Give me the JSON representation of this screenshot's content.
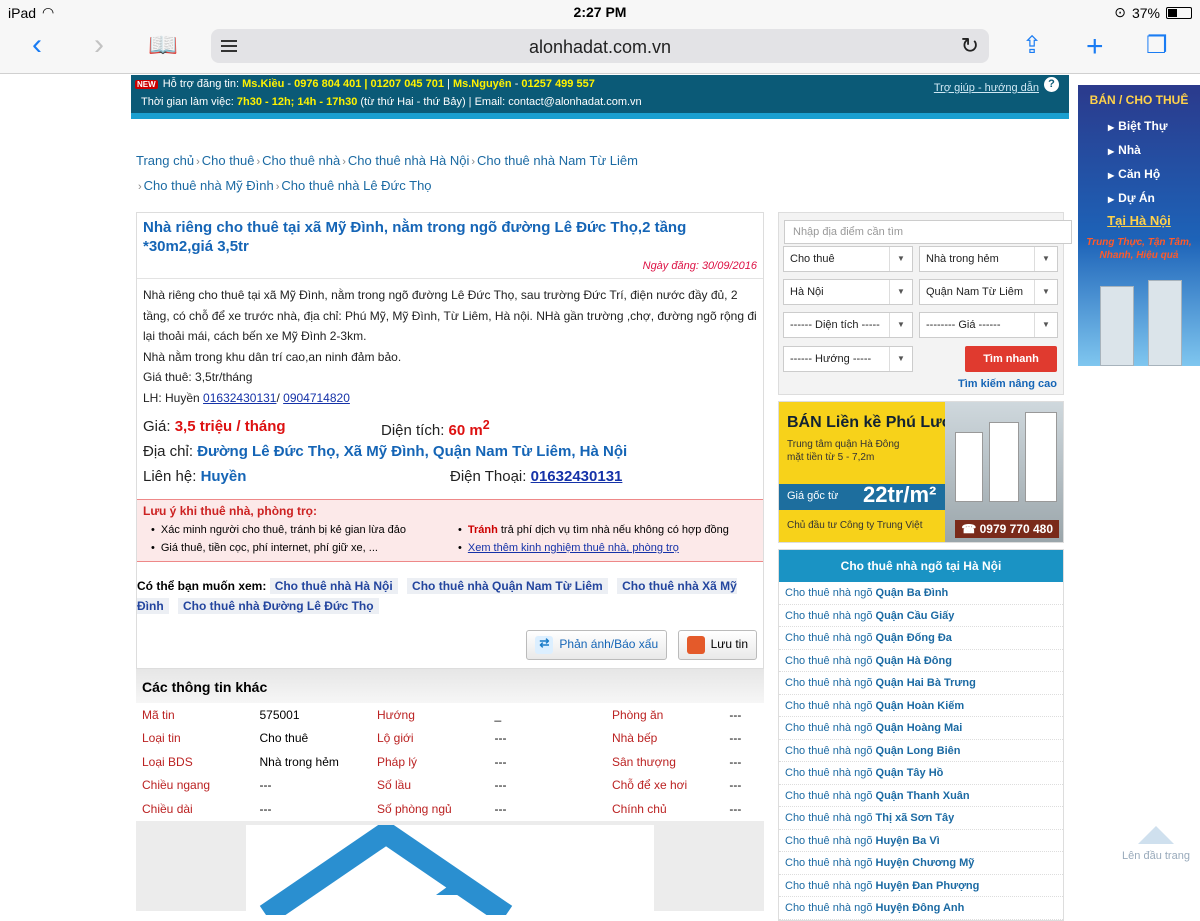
{
  "status": {
    "device": "iPad",
    "time": "2:27 PM",
    "battery": "37%",
    "battery_level": 0.37
  },
  "browser": {
    "url": "alonhadat.com.vn"
  },
  "topbar": {
    "badge": "NEW",
    "support_label": "Hỗ trợ đăng tin:",
    "name1": "Ms.Kiều",
    "phones1": "0976 804 401 | 01207 045 701",
    "name2": "Ms.Nguyên",
    "phones2": "01257 499 557",
    "hours_label": "Thời gian làm việc:",
    "hours": "7h30 - 12h; 14h - 17h30",
    "hours_rest": "(từ thứ Hai - thứ Bảy) | Email: contact@alonhadat.com.vn",
    "help": "Trợ giúp - hướng dẫn"
  },
  "breadcrumb": [
    "Trang chủ",
    "Cho thuê",
    "Cho thuê nhà",
    "Cho thuê nhà Hà Nội",
    "Cho thuê nhà Nam Từ Liêm",
    "Cho thuê nhà Mỹ Đình",
    "Cho thuê nhà Lê Đức Thọ"
  ],
  "listing": {
    "title": "Nhà riêng cho thuê tại xã Mỹ Đình, nằm trong ngõ đường Lê Đức Thọ,2 tầng *30m2,giá 3,5tr",
    "date": "Ngày đăng: 30/09/2016",
    "desc1": "Nhà riêng cho thuê tại xã Mỹ Đình, nằm trong ngõ đường Lê Đức Thọ, sau trường Đức Trí, điện nước đầy đủ, 2 tầng, có chỗ để xe trước nhà, địa chỉ:  Phú Mỹ, Mỹ Đình, Từ Liêm, Hà nội. NHà gần trường ,chợ, đường ngõ rộng đi lại thoải mái, cách bến xe Mỹ Đình 2-3km.",
    "desc2": "Nhà nằm trong khu dân trí cao,an ninh đảm bảo.",
    "desc3": "Giá thuê: 3,5tr/tháng",
    "contact_prefix": "LH: Huyền",
    "phone_a": "01632430131",
    "phone_b": "0904714820",
    "price_label": "Giá:",
    "price": "3,5 triệu / tháng",
    "area_label": "Diện tích:",
    "area": "60 m",
    "area_sup": "2",
    "address_label": "Địa chỉ:",
    "address": "Đường Lê Đức Thọ, Xã Mỹ Đình, Quận Nam Từ Liêm, Hà Nội",
    "contact_label": "Liên hệ:",
    "contact_name": "Huyền",
    "tel_label": "Điện Thoại:",
    "tel": "01632430131"
  },
  "notice": {
    "title": "Lưu ý khi thuê nhà, phòng trọ:",
    "a1": "Xác minh người cho thuê, tránh bị kẻ gian lừa đảo",
    "a2": "Giá thuê, tiền cọc, phí internet, phí giữ xe, ...",
    "b1_strong": "Tránh",
    "b1": "trả phí dịch vụ tìm nhà nếu không có hợp đồng",
    "b2": "Xem thêm kinh nghiệm thuê nhà, phòng trọ"
  },
  "suggest": {
    "label": "Có thể bạn muốn xem:",
    "tags": [
      "Cho thuê nhà Hà Nội",
      "Cho thuê nhà Quận Nam Từ Liêm",
      "Cho thuê nhà Xã Mỹ Đình",
      "Cho thuê nhà Đường Lê Đức Thọ"
    ]
  },
  "actions": {
    "report": "Phản ánh/Báo xấu",
    "save": "Lưu tin"
  },
  "other": {
    "title": "Các thông tin khác",
    "rows": [
      [
        "Mã tin",
        "575001",
        "Hướng",
        "_",
        "Phòng ăn",
        "---"
      ],
      [
        "Loại tin",
        "Cho thuê",
        "Lộ giới",
        "---",
        "Nhà bếp",
        "---"
      ],
      [
        "Loại BDS",
        "Nhà trong hẻm",
        "Pháp lý",
        "---",
        "Sân thượng",
        "---"
      ],
      [
        "Chiều ngang",
        "---",
        "Số lầu",
        "---",
        "Chỗ để xe hơi",
        "---"
      ],
      [
        "Chiều dài",
        "---",
        "Số phòng ngủ",
        "---",
        "Chính chủ",
        "---"
      ]
    ]
  },
  "search": {
    "placeholder": "Nhập địa điểm cần tìm",
    "type": "Cho thuê",
    "kind": "Nhà trong hẻm",
    "city": "Hà Nội",
    "district": "Quận Nam Từ Liêm",
    "area": "------ Diện tích -----",
    "price": "-------- Giá ------",
    "direction": "------ Hướng -----",
    "button": "Tìm nhanh",
    "advanced": "Tìm kiếm nâng cao"
  },
  "ad": {
    "title": "BÁN Liền kề Phú Lương",
    "line1": "Trung tâm quận Hà Đông",
    "line2": "mặt tiền từ 5 - 7,2m",
    "price_label": "Giá gốc từ",
    "price": "22tr/m²",
    "owner": "Chủ đầu tư Công ty Trung Việt",
    "hotline": "☎ 0979 770 480"
  },
  "sidelist": {
    "title": "Cho thuê nhà ngõ tại Hà Nội",
    "prefix": "Cho thuê nhà ngõ",
    "items": [
      "Quận Ba Đình",
      "Quận Cầu Giấy",
      "Quận Đống Đa",
      "Quận Hà Đông",
      "Quận Hai Bà Trưng",
      "Quận Hoàn Kiếm",
      "Quận Hoàng Mai",
      "Quận Long Biên",
      "Quận Tây Hồ",
      "Quận Thanh Xuân",
      "Thị xã Sơn Tây",
      "Huyện Ba Vì",
      "Huyện Chương Mỹ",
      "Huyện Đan Phượng",
      "Huyện Đông Anh"
    ]
  },
  "banner": {
    "head": "BÁN / CHO THUÊ",
    "items": [
      "Biệt Thự",
      "Nhà",
      "Căn Hộ",
      "Dự Án"
    ],
    "place": "Tại Hà Nội",
    "slogan1": "Trung Thực, Tận Tâm,",
    "slogan2": "Nhanh, Hiệu quả"
  },
  "totop": "Lên đầu trang"
}
